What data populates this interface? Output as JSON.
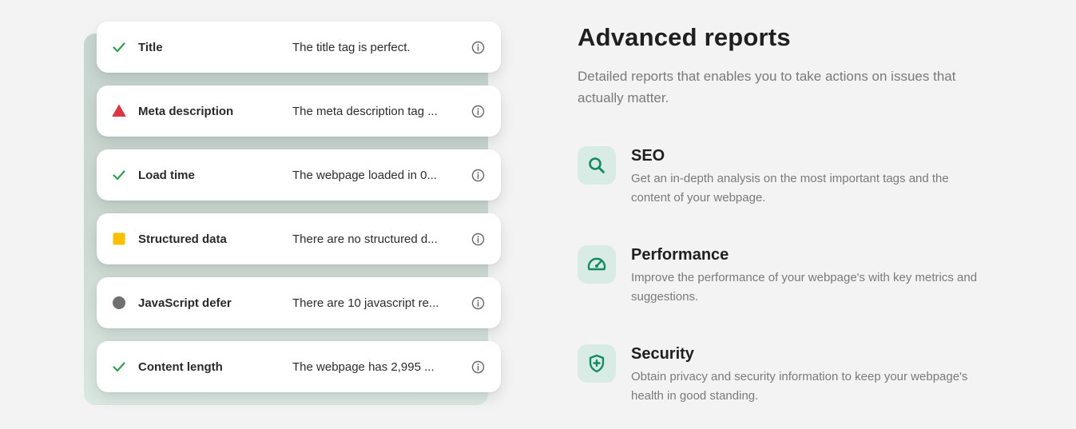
{
  "checks": [
    {
      "status": "pass",
      "status_icon": "checkmark-icon",
      "name": "Title",
      "message": "The title tag is perfect."
    },
    {
      "status": "error",
      "status_icon": "warning-triangle-icon",
      "name": "Meta description",
      "message": "The meta description tag ..."
    },
    {
      "status": "pass",
      "status_icon": "checkmark-icon",
      "name": "Load time",
      "message": "The webpage loaded in 0..."
    },
    {
      "status": "warning",
      "status_icon": "square-icon",
      "name": "Structured data",
      "message": "There are no structured d..."
    },
    {
      "status": "info",
      "status_icon": "circle-icon",
      "name": "JavaScript defer",
      "message": "There are 10 javascript re..."
    },
    {
      "status": "pass",
      "status_icon": "checkmark-icon",
      "name": "Content length",
      "message": "The webpage has 2,995 ..."
    }
  ],
  "section": {
    "title": "Advanced reports",
    "subtitle": "Detailed reports that enables you to take actions on issues that actually matter."
  },
  "features": [
    {
      "icon": "search-icon",
      "name": "SEO",
      "description": "Get an in-depth analysis on the most important tags and the content of your webpage."
    },
    {
      "icon": "speedometer-icon",
      "name": "Performance",
      "description": "Improve the performance of your webpage's with key metrics and suggestions."
    },
    {
      "icon": "shield-plus-icon",
      "name": "Security",
      "description": "Obtain privacy and security information to keep your webpage's health in good standing."
    }
  ],
  "colors": {
    "pass": "#2e9e4f",
    "error": "#dc3545",
    "warning": "#fbbf00",
    "info": "#707070",
    "accent": "#148a62",
    "icon_bg": "#d8ebe4"
  }
}
